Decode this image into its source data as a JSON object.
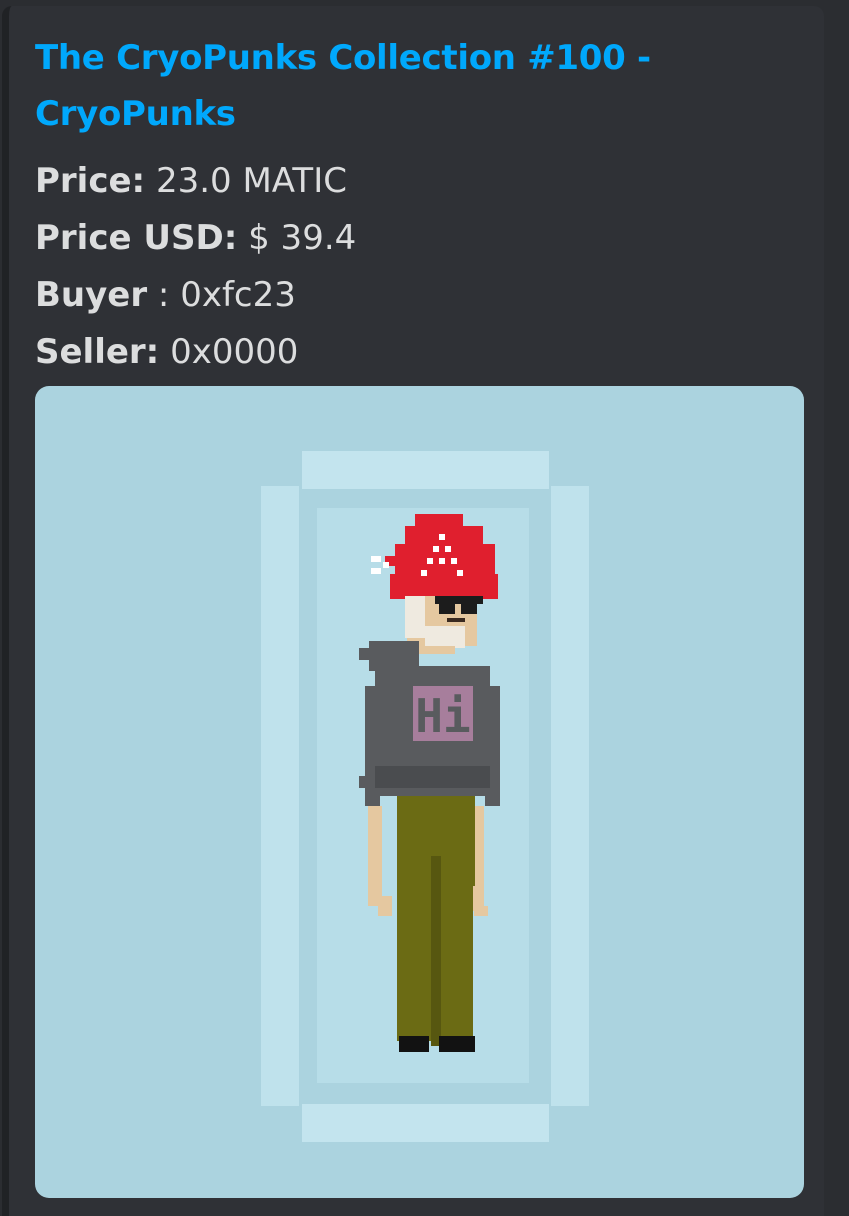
{
  "embed": {
    "title": "The CryoPunks Collection #100 - CryoPunks",
    "fields": [
      {
        "label": "Price:",
        "value": " 23.0 MATIC"
      },
      {
        "label": "Price USD:",
        "value": " $ 39.4"
      },
      {
        "label": "Buyer",
        "value": " : 0xfc23"
      },
      {
        "label": "Seller:",
        "value": " 0x0000"
      }
    ]
  },
  "nft_image": {
    "subject": "pixel-art-punk-character",
    "shirt_text": "Hi",
    "colors": {
      "background": "#abd3df",
      "ice_block": "#b7dde8",
      "ice_edge": "#c3e4ee",
      "hat": "#e01f2e",
      "hoodie": "#595b5e",
      "pants": "#6b6b14",
      "skin": "#e5c8a0",
      "shirt_letters": "#a77e9c"
    }
  }
}
